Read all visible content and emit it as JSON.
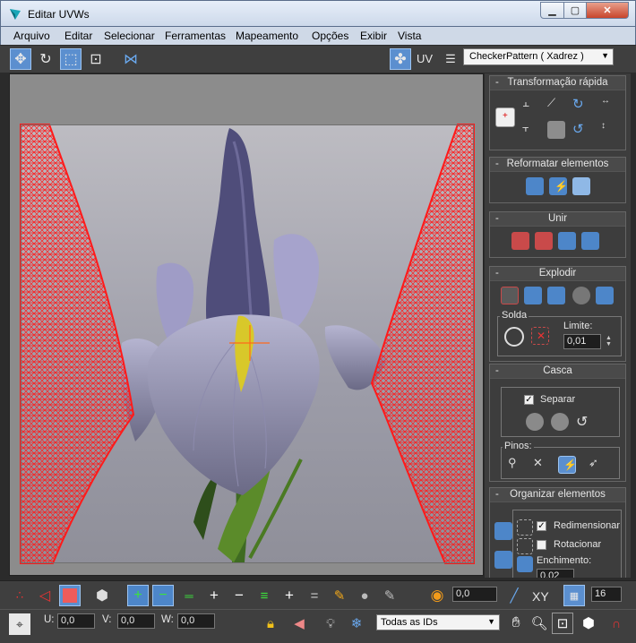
{
  "window": {
    "title": "Editar UVWs"
  },
  "menu": [
    "Arquivo",
    "Editar",
    "Selecionar",
    "Ferramentas",
    "Mapeamento",
    "Opções",
    "Exibir",
    "Vista"
  ],
  "toolbar": {
    "uv_label": "UV",
    "texture_select": "CheckerPattern  ( Xadrez )"
  },
  "panel": {
    "quick_transform": {
      "title": "Transformação rápida"
    },
    "reshape": {
      "title": "Reformatar elementos"
    },
    "stitch": {
      "title": "Unir"
    },
    "explode": {
      "title": "Explodir",
      "weld_label": "Solda",
      "threshold_label": "Limite:",
      "threshold_value": "0,01"
    },
    "peel": {
      "title": "Casca",
      "detach_label": "Separar",
      "detach_checked": true,
      "pins_label": "Pinos:"
    },
    "arrange": {
      "title": "Organizar elementos",
      "rescale_label": "Redimensionar",
      "rescale_checked": true,
      "rotate_label": "Rotacionar",
      "rotate_checked": false,
      "padding_label": "Enchimento:",
      "padding_value": "0,02"
    }
  },
  "bottom": {
    "soft_value": "0,0",
    "xy_label": "XY",
    "grid_value": "16",
    "u_label": "U:",
    "u_value": "0,0",
    "v_label": "V:",
    "v_value": "0,0",
    "w_label": "W:",
    "w_value": "0,0",
    "ids_select": "Todas as IDs"
  },
  "colors": {
    "wire": "#ff1a1a",
    "panel_bg": "#3d3d3d",
    "toolbar_bg": "#3f3f3f",
    "active_blue": "#5b8fcf"
  }
}
